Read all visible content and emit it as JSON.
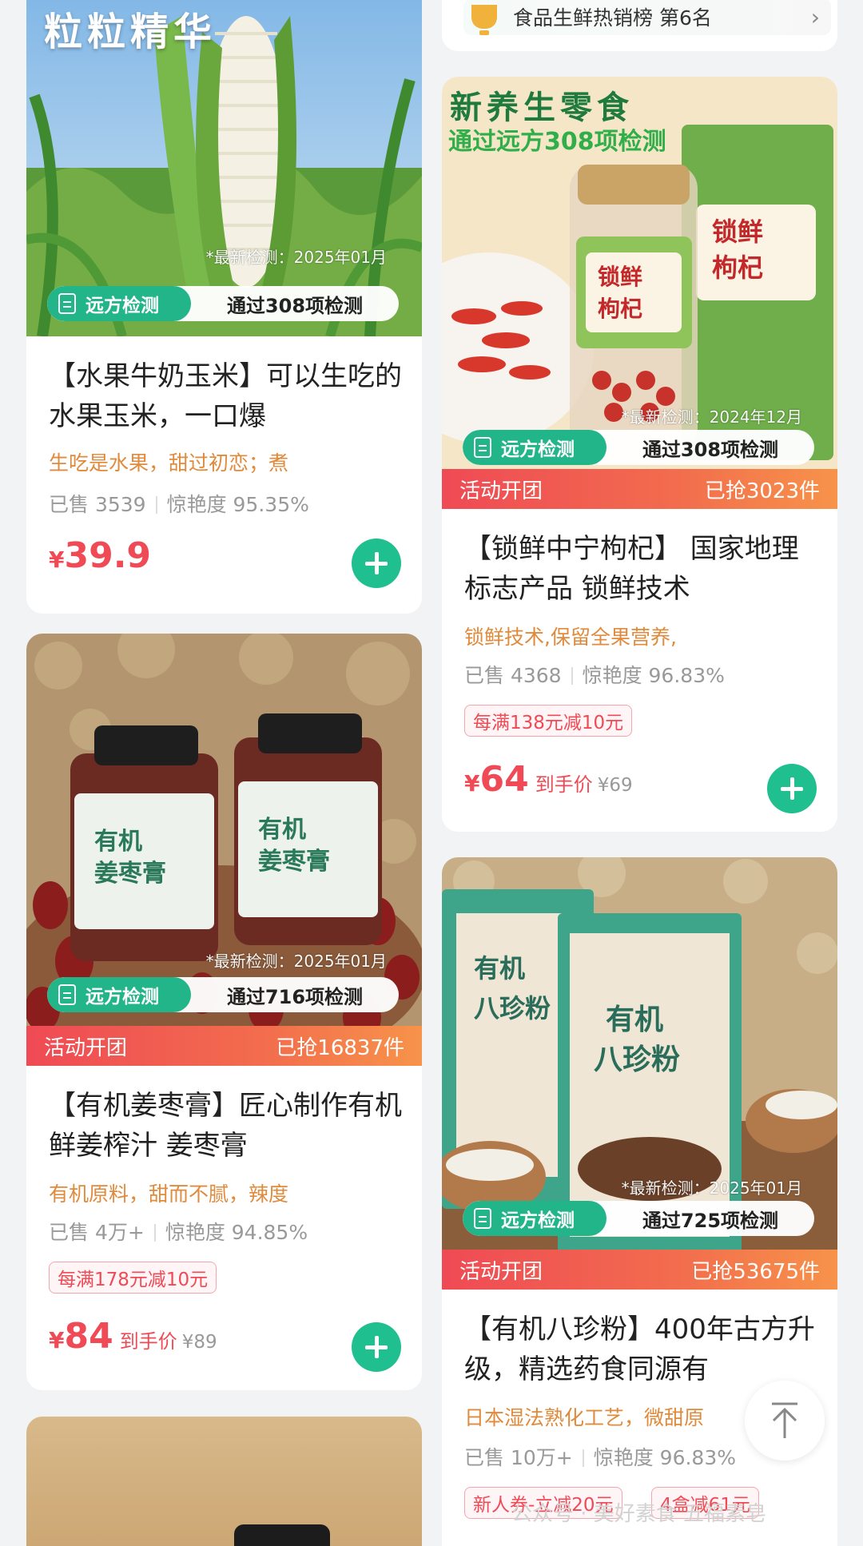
{
  "left_column": {
    "card1": {
      "headline": "粒粒精华",
      "test_date": "*最新检测：2025年01月",
      "badge_brand": "远方检测",
      "badge_pass": "通过308项检测",
      "title": "【水果牛奶玉米】可以生吃的水果玉米，一口爆",
      "feature": "生吃是水果，甜过初恋；煮",
      "sold": "已售 3539",
      "rating": "惊艳度 95.35%",
      "price_symbol": "¥",
      "price": "39.9"
    },
    "card2": {
      "test_date": "*最新检测：2025年01月",
      "badge_brand": "远方检测",
      "badge_pass": "通过716项检测",
      "promo_left": "活动开团",
      "promo_right": "已抢16837件",
      "title": "【有机姜枣膏】匠心制作有机鲜姜榨汁 姜枣膏",
      "feature": "有机原料，甜而不腻，辣度",
      "sold": "已售 4万+",
      "rating": "惊艳度 94.85%",
      "coupon": "每满178元减10元",
      "price_symbol": "¥",
      "price": "84",
      "price_label": "到手价",
      "orig_price": "¥89"
    }
  },
  "right_column": {
    "rank_strip": {
      "text": "食品生鲜热销榜 第6名",
      "chevron": "›"
    },
    "card1": {
      "headline": "新养生零食",
      "subline": "通过远方308项检测",
      "test_date": "*最新检测：2024年12月",
      "badge_brand": "远方检测",
      "badge_pass": "通过308项检测",
      "promo_left": "活动开团",
      "promo_right": "已抢3023件",
      "title": "【锁鲜中宁枸杞】 国家地理标志产品 锁鲜技术",
      "feature": "锁鲜技术,保留全果营养,",
      "sold": "已售 4368",
      "rating": "惊艳度 96.83%",
      "coupon": "每满138元减10元",
      "price_symbol": "¥",
      "price": "64",
      "price_label": "到手价",
      "orig_price": "¥69"
    },
    "card2": {
      "test_date": "*最新检测：2025年01月",
      "badge_brand": "远方检测",
      "badge_pass": "通过725项检测",
      "promo_left": "活动开团",
      "promo_right": "已抢53675件",
      "title": "【有机八珍粉】400年古方升级，精选药食同源有",
      "feature": "日本湿法熟化工艺，微甜原",
      "sold": "已售 10万+",
      "rating": "惊艳度 96.83%",
      "coupon1": "新人券-立减20元",
      "coupon2": "4盒减61元"
    }
  },
  "watermark": "公众号 · 美好素食 五福素皂",
  "colors": {
    "accent_green": "#1fbf8f",
    "price_red": "#ef4a55",
    "feature_orange": "#e08a3c"
  }
}
